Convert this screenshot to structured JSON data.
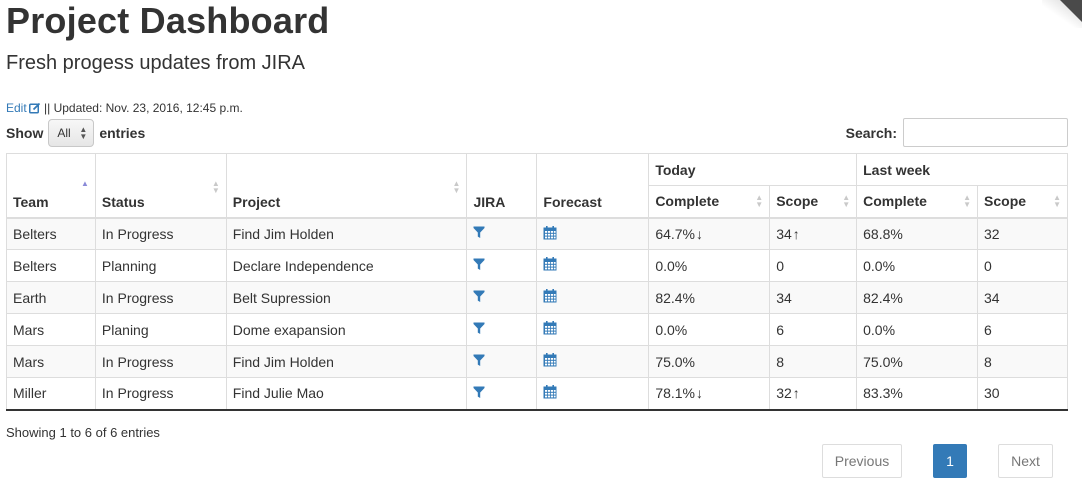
{
  "header": {
    "title": "Project Dashboard",
    "subtitle": "Fresh progess updates from JIRA",
    "edit_label": "Edit",
    "updated_text": " || Updated: Nov. 23, 2016, 12:45 p.m."
  },
  "controls": {
    "show_label": "Show",
    "entries_value": "All",
    "entries_label": "entries",
    "search_label": "Search:",
    "search_value": ""
  },
  "table": {
    "group_headers": {
      "today": "Today",
      "last_week": "Last week"
    },
    "columns": {
      "team": "Team",
      "status": "Status",
      "project": "Project",
      "jira": "JIRA",
      "forecast": "Forecast",
      "today_complete": "Complete",
      "today_scope": "Scope",
      "lw_complete": "Complete",
      "lw_scope": "Scope"
    },
    "rows": [
      {
        "team": "Belters",
        "status": "In Progress",
        "project": "Find Jim Holden",
        "today_complete": "64.7%",
        "today_complete_arrow": "↓",
        "today_scope": "34",
        "today_scope_arrow": "↑",
        "lw_complete": "68.8%",
        "lw_scope": "32"
      },
      {
        "team": "Belters",
        "status": "Planning",
        "project": "Declare Independence",
        "today_complete": "0.0%",
        "today_complete_arrow": "",
        "today_scope": "0",
        "today_scope_arrow": "",
        "lw_complete": "0.0%",
        "lw_scope": "0"
      },
      {
        "team": "Earth",
        "status": "In Progress",
        "project": "Belt Supression",
        "today_complete": "82.4%",
        "today_complete_arrow": "",
        "today_scope": "34",
        "today_scope_arrow": "",
        "lw_complete": "82.4%",
        "lw_scope": "34"
      },
      {
        "team": "Mars",
        "status": "Planing",
        "project": "Dome exapansion",
        "today_complete": "0.0%",
        "today_complete_arrow": "",
        "today_scope": "6",
        "today_scope_arrow": "",
        "lw_complete": "0.0%",
        "lw_scope": "6"
      },
      {
        "team": "Mars",
        "status": "In Progress",
        "project": "Find Jim Holden",
        "today_complete": "75.0%",
        "today_complete_arrow": "",
        "today_scope": "8",
        "today_scope_arrow": "",
        "lw_complete": "75.0%",
        "lw_scope": "8"
      },
      {
        "team": "Miller",
        "status": "In Progress",
        "project": "Find Julie Mao",
        "today_complete": "78.1%",
        "today_complete_arrow": "↓",
        "today_scope": "32",
        "today_scope_arrow": "↑",
        "lw_complete": "83.3%",
        "lw_scope": "30"
      }
    ],
    "icons": {
      "jira": "filter-icon",
      "forecast": "calendar-icon"
    }
  },
  "footer": {
    "info": "Showing 1 to 6 of 6 entries",
    "previous": "Previous",
    "current_page": "1",
    "next": "Next"
  },
  "colors": {
    "accent": "#337ab7",
    "text": "#333333",
    "border": "#dddddd",
    "stripe": "#f9f9f9"
  }
}
